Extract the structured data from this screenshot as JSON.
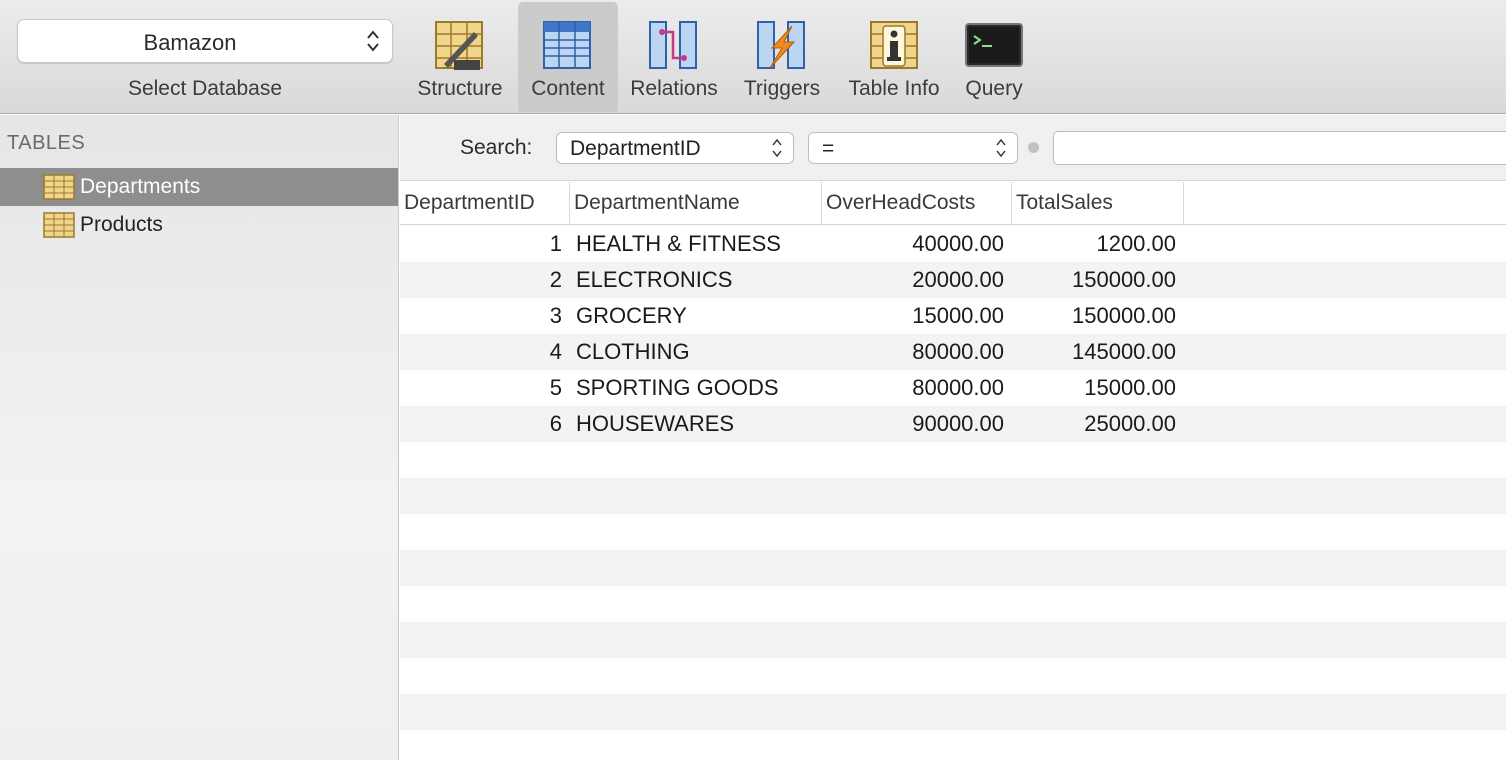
{
  "toolbar": {
    "database": {
      "value": "Bamazon",
      "label": "Select Database"
    },
    "tools": [
      {
        "label": "Structure"
      },
      {
        "label": "Content"
      },
      {
        "label": "Relations"
      },
      {
        "label": "Triggers"
      },
      {
        "label": "Table Info"
      },
      {
        "label": "Query"
      }
    ],
    "active_tool": "Content"
  },
  "sidebar": {
    "heading": "TABLES",
    "tables": [
      {
        "name": "Departments",
        "selected": true
      },
      {
        "name": "Products",
        "selected": false
      }
    ]
  },
  "filter": {
    "label": "Search:",
    "field": "DepartmentID",
    "operator": "=",
    "value": ""
  },
  "table": {
    "columns": [
      "DepartmentID",
      "DepartmentName",
      "OverHeadCosts",
      "TotalSales"
    ],
    "rows": [
      [
        "1",
        "HEALTH & FITNESS",
        "40000.00",
        "1200.00"
      ],
      [
        "2",
        "ELECTRONICS",
        "20000.00",
        "150000.00"
      ],
      [
        "3",
        "GROCERY",
        "15000.00",
        "150000.00"
      ],
      [
        "4",
        "CLOTHING",
        "80000.00",
        "145000.00"
      ],
      [
        "5",
        "SPORTING GOODS",
        "80000.00",
        "15000.00"
      ],
      [
        "6",
        "HOUSEWARES",
        "90000.00",
        "25000.00"
      ]
    ]
  }
}
